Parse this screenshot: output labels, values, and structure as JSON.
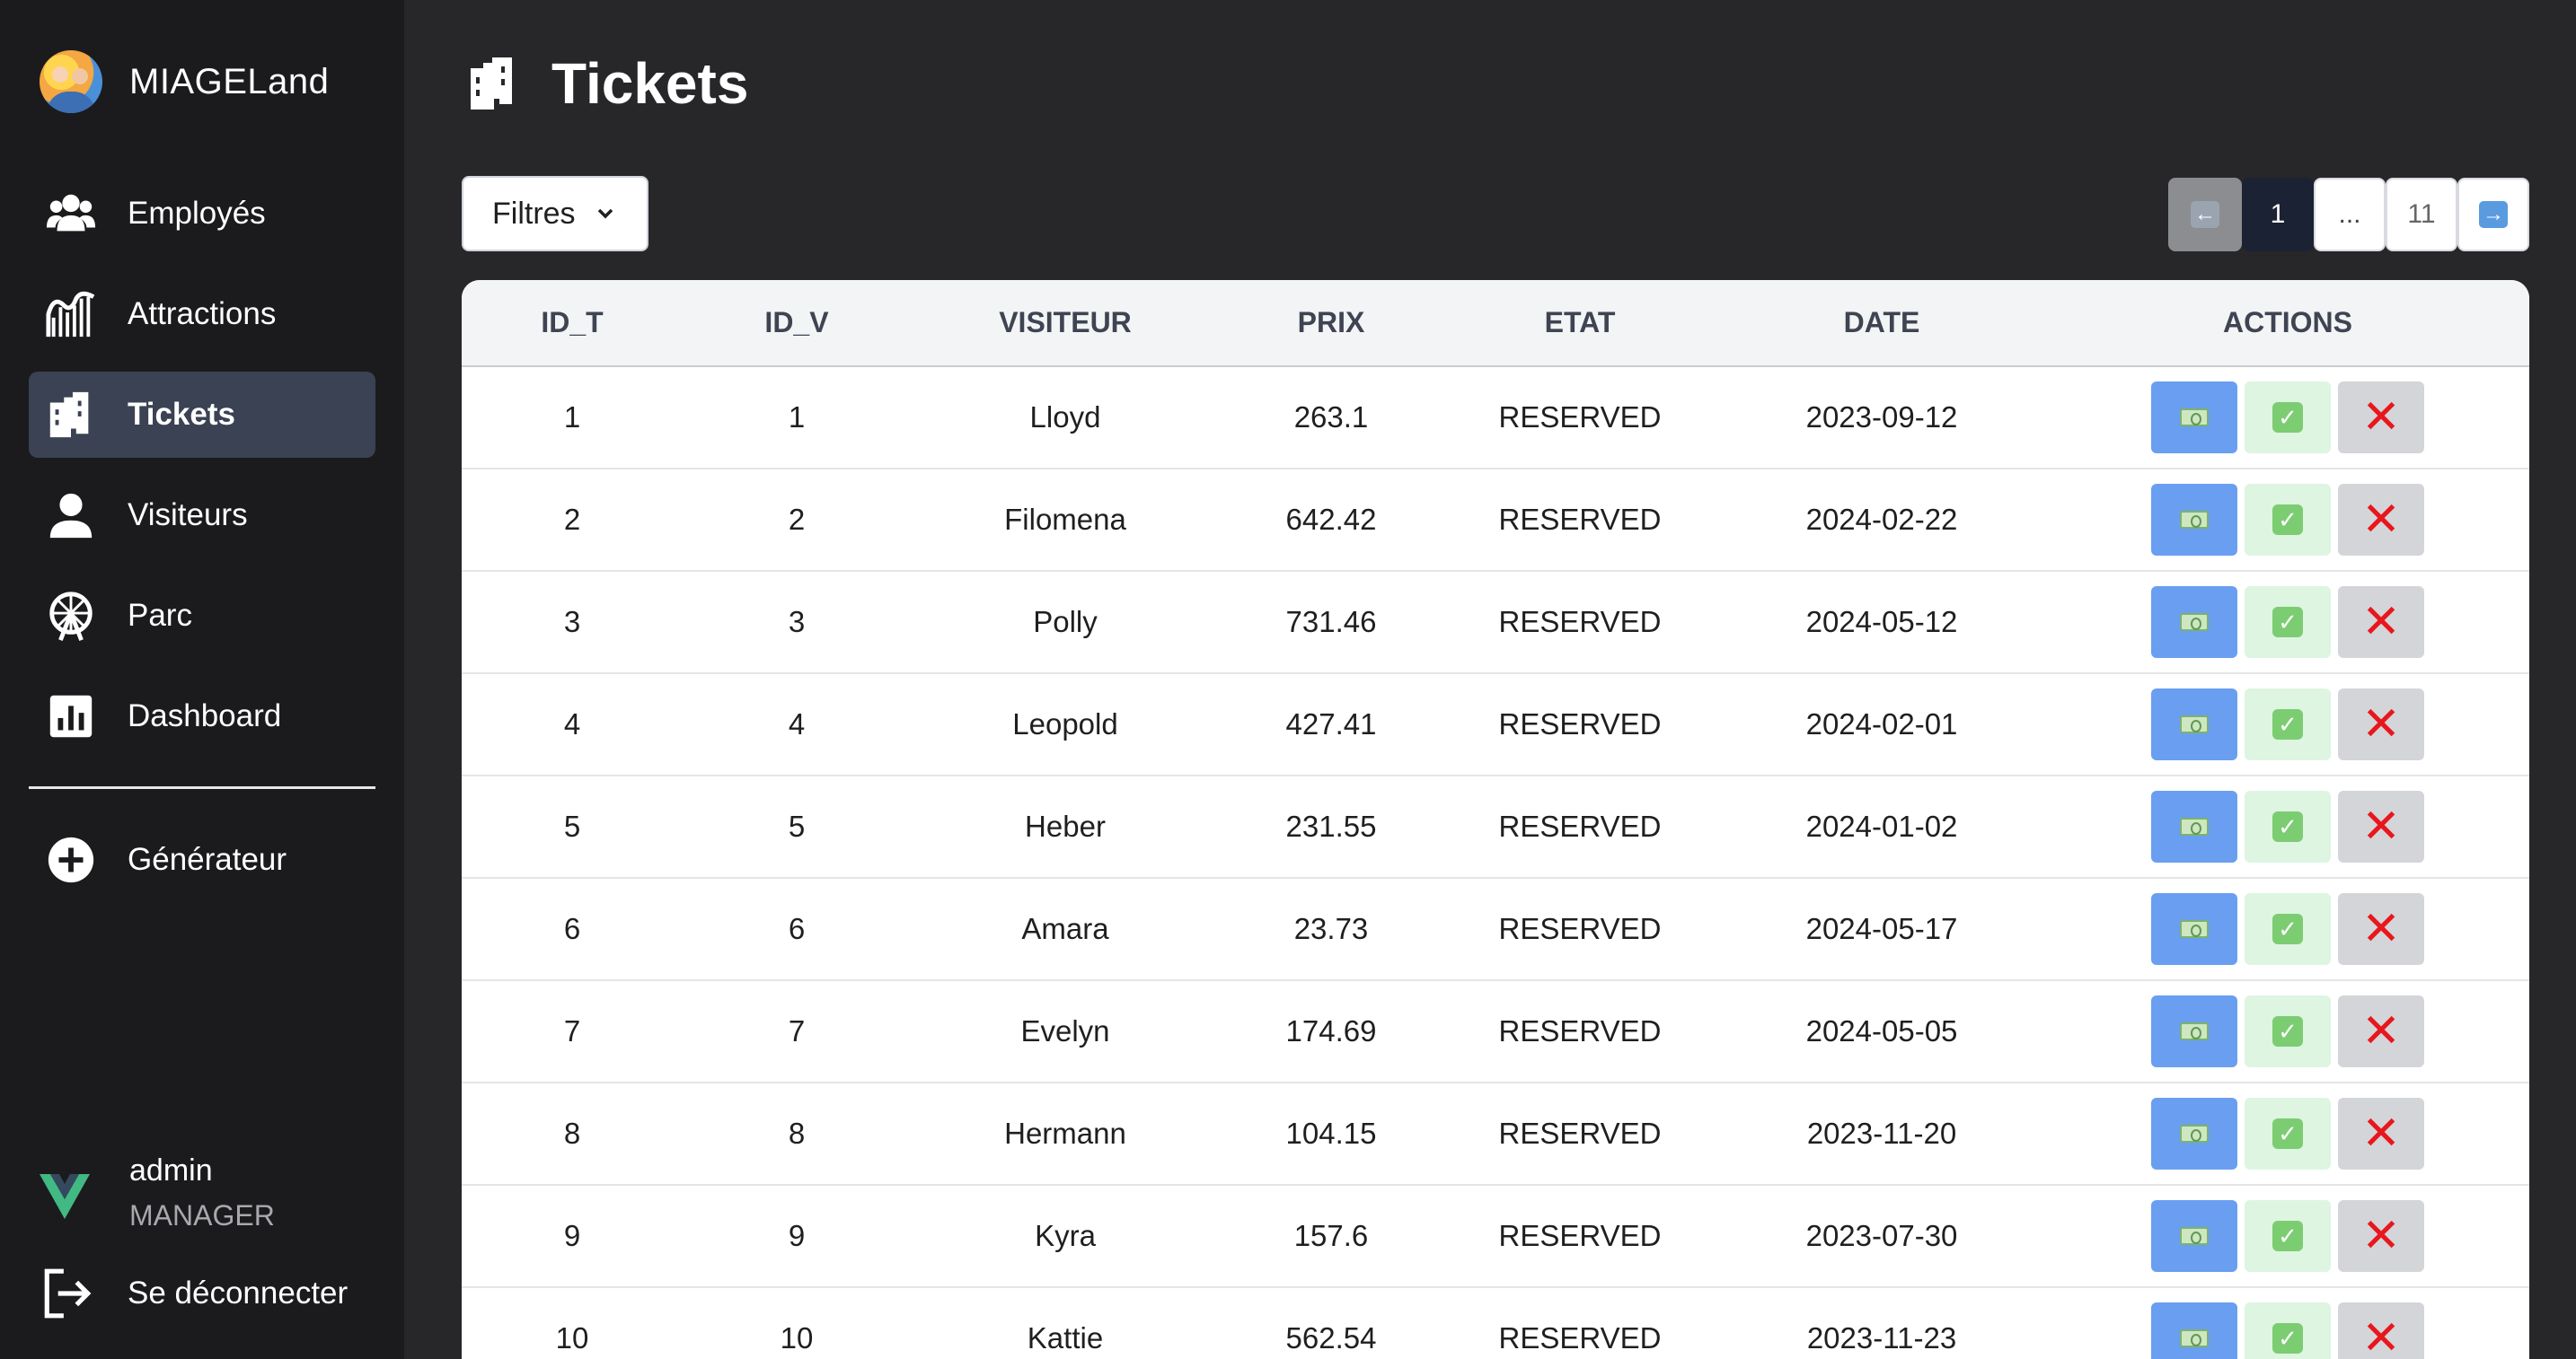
{
  "app": {
    "name": "MIAGELand"
  },
  "sidebar": {
    "items": [
      {
        "label": "Employés",
        "icon": "users-icon",
        "active": false
      },
      {
        "label": "Attractions",
        "icon": "rollercoaster-icon",
        "active": false
      },
      {
        "label": "Tickets",
        "icon": "ticket-icon",
        "active": true
      },
      {
        "label": "Visiteurs",
        "icon": "user-icon",
        "active": false
      },
      {
        "label": "Parc",
        "icon": "ferris-wheel-icon",
        "active": false
      },
      {
        "label": "Dashboard",
        "icon": "chart-icon",
        "active": false
      }
    ],
    "generator": {
      "label": "Générateur",
      "icon": "plus-circle-icon"
    },
    "user": {
      "name": "admin",
      "role": "MANAGER"
    },
    "logout": {
      "label": "Se déconnecter",
      "icon": "logout-icon"
    }
  },
  "page": {
    "title": "Tickets",
    "filter_label": "Filtres",
    "pagination": {
      "current": "1",
      "ellipsis": "...",
      "last": "11"
    }
  },
  "table": {
    "headers": [
      "ID_T",
      "ID_V",
      "VISITEUR",
      "PRIX",
      "ETAT",
      "DATE",
      "ACTIONS"
    ],
    "rows": [
      [
        "1",
        "1",
        "Lloyd",
        "263.1",
        "RESERVED",
        "2023-09-12"
      ],
      [
        "2",
        "2",
        "Filomena",
        "642.42",
        "RESERVED",
        "2024-02-22"
      ],
      [
        "3",
        "3",
        "Polly",
        "731.46",
        "RESERVED",
        "2024-05-12"
      ],
      [
        "4",
        "4",
        "Leopold",
        "427.41",
        "RESERVED",
        "2024-02-01"
      ],
      [
        "5",
        "5",
        "Heber",
        "231.55",
        "RESERVED",
        "2024-01-02"
      ],
      [
        "6",
        "6",
        "Amara",
        "23.73",
        "RESERVED",
        "2024-05-17"
      ],
      [
        "7",
        "7",
        "Evelyn",
        "174.69",
        "RESERVED",
        "2024-05-05"
      ],
      [
        "8",
        "8",
        "Hermann",
        "104.15",
        "RESERVED",
        "2023-11-20"
      ],
      [
        "9",
        "9",
        "Kyra",
        "157.6",
        "RESERVED",
        "2023-07-30"
      ],
      [
        "10",
        "10",
        "Kattie",
        "562.54",
        "RESERVED",
        "2023-11-23"
      ]
    ]
  },
  "colors": {
    "sidebar_bg": "#1b1b1d",
    "main_bg": "#272729",
    "active_nav": "#3a4253",
    "pay_button": "#6a9ef0",
    "validate_button": "#def5e1",
    "cancel_button": "#d4d5d8",
    "cancel_icon": "#e8171d"
  }
}
